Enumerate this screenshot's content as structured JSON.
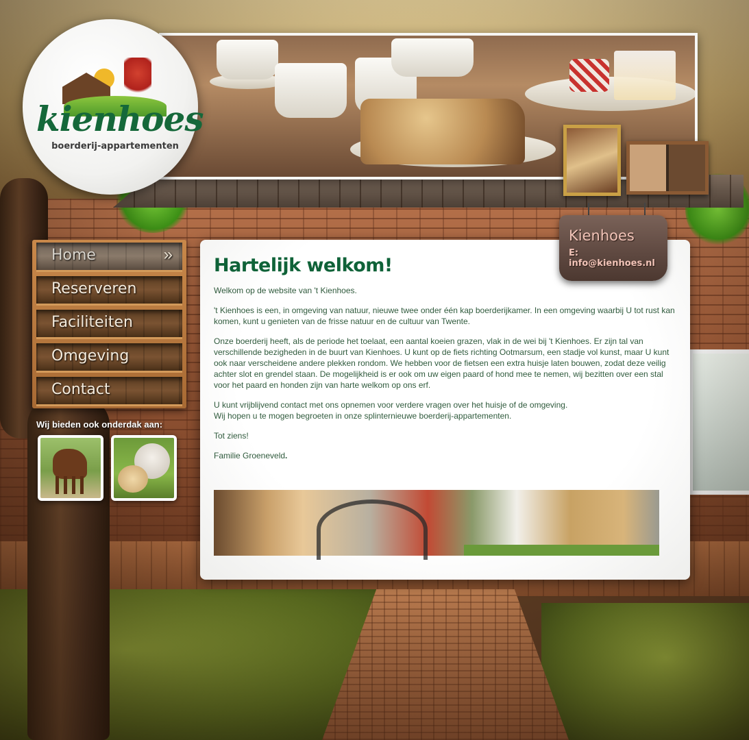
{
  "logo": {
    "wordmark": "kienhoes",
    "tagline": "boerderij-appartementen"
  },
  "nav": {
    "items": [
      {
        "label": "Home",
        "active": true
      },
      {
        "label": "Reserveren",
        "active": false
      },
      {
        "label": "Faciliteiten",
        "active": false
      },
      {
        "label": "Omgeving",
        "active": false
      },
      {
        "label": "Contact",
        "active": false
      }
    ],
    "active_arrow": "»"
  },
  "offers": {
    "title": "Wij bieden ook onderdak aan:",
    "items": [
      "horse-photo",
      "dog-photo"
    ]
  },
  "sign": {
    "title": "Kienhoes",
    "email": "E: info@kienhoes.nl"
  },
  "main": {
    "title": "Hartelijk welkom!",
    "paragraphs": [
      "Welkom op de website van 't Kienhoes.",
      "'t Kienhoes is een, in omgeving van natuur, nieuwe twee onder één kap boerderijkamer. In een omgeving waarbij U tot rust kan komen, kunt u genieten van de frisse natuur en de cultuur van Twente.",
      "Onze boerderij heeft, als de periode het toelaat, een aantal koeien grazen, vlak in de wei bij 't Kienhoes. Er zijn tal van verschillende bezigheden in de buurt van Kienhoes. U kunt op de fiets richting Ootmarsum, een stadje vol kunst, maar U kunt ook naar verscheidene andere plekken rondom. We hebben voor de fietsen een extra huisje laten bouwen, zodat deze veilig achter slot en grendel staan. De mogelijkheid is er ook om uw eigen paard of hond mee te nemen, wij bezitten over een stal voor het paard en honden zijn van harte welkom op ons erf.",
      "U kunt vrijblijvend contact met ons opnemen voor verdere vragen over het huisje of de omgeving.",
      "Wij hopen u te mogen begroeten in onze splinternieuwe boerderij-appartementen.",
      "Tot ziens!",
      "Familie Groeneveld"
    ],
    "signature_dot": "."
  },
  "colors": {
    "title_green": "#0f6238",
    "text_green": "#2f5a3c",
    "logo_green": "#15683a",
    "sign_text": "#f2c4b8"
  }
}
